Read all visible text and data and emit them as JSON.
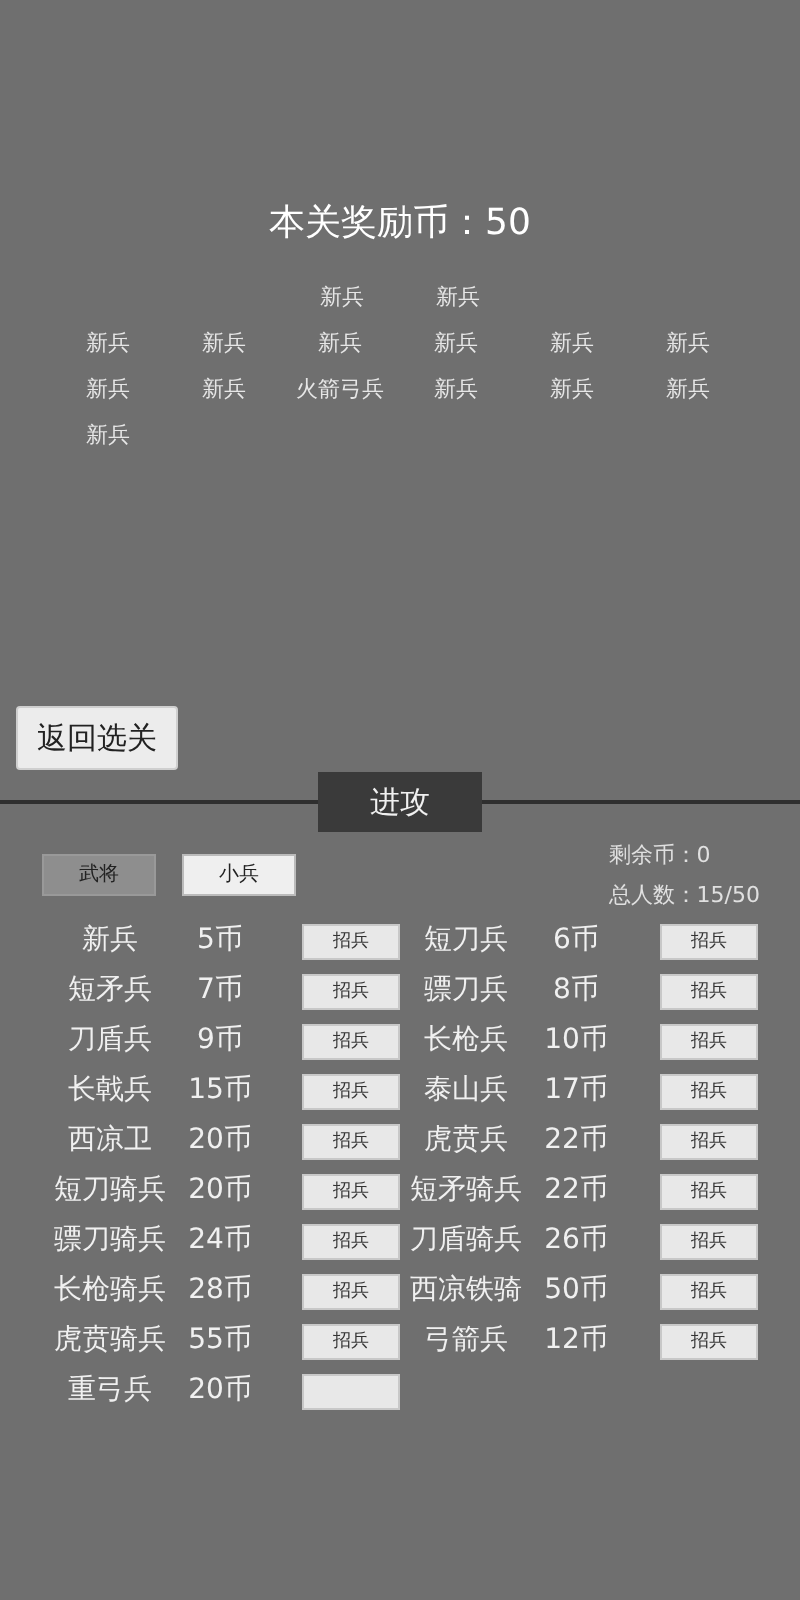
{
  "reward_title": "本关奖励币：50",
  "formation": [
    {
      "units": [
        "新兵",
        "新兵"
      ]
    },
    {
      "units": [
        "新兵",
        "新兵",
        "新兵",
        "新兵",
        "新兵",
        "新兵"
      ]
    },
    {
      "units": [
        "新兵",
        "新兵",
        "火箭弓兵",
        "新兵",
        "新兵",
        "新兵"
      ]
    },
    {
      "units": [
        "新兵"
      ]
    }
  ],
  "back_button": "返回选关",
  "attack_button": "进攻",
  "tabs": [
    {
      "label": "武将",
      "selected": false
    },
    {
      "label": "小兵",
      "selected": true
    }
  ],
  "stats": [
    "剩余币：0",
    "总人数：15/50"
  ],
  "recruits": [
    {
      "name": "新兵",
      "cost": "5币",
      "button": "招兵"
    },
    {
      "name": "短刀兵",
      "cost": "6币",
      "button": "招兵"
    },
    {
      "name": "短矛兵",
      "cost": "7币",
      "button": "招兵"
    },
    {
      "name": "骠刀兵",
      "cost": "8币",
      "button": "招兵"
    },
    {
      "name": "刀盾兵",
      "cost": "9币",
      "button": "招兵"
    },
    {
      "name": "长枪兵",
      "cost": "10币",
      "button": "招兵"
    },
    {
      "name": "长戟兵",
      "cost": "15币",
      "button": "招兵"
    },
    {
      "name": "泰山兵",
      "cost": "17币",
      "button": "招兵"
    },
    {
      "name": "西凉卫",
      "cost": "20币",
      "button": "招兵"
    },
    {
      "name": "虎贲兵",
      "cost": "22币",
      "button": "招兵"
    },
    {
      "name": "短刀骑兵",
      "cost": "20币",
      "button": "招兵"
    },
    {
      "name": "短矛骑兵",
      "cost": "22币",
      "button": "招兵"
    },
    {
      "name": "骠刀骑兵",
      "cost": "24币",
      "button": "招兵"
    },
    {
      "name": "刀盾骑兵",
      "cost": "26币",
      "button": "招兵"
    },
    {
      "name": "长枪骑兵",
      "cost": "28币",
      "button": "招兵"
    },
    {
      "name": "西凉铁骑",
      "cost": "50币",
      "button": "招兵"
    },
    {
      "name": "虎贲骑兵",
      "cost": "55币",
      "button": "招兵"
    },
    {
      "name": "弓箭兵",
      "cost": "12币",
      "button": "招兵"
    },
    {
      "name": "重弓兵",
      "cost": "20币"
    }
  ]
}
